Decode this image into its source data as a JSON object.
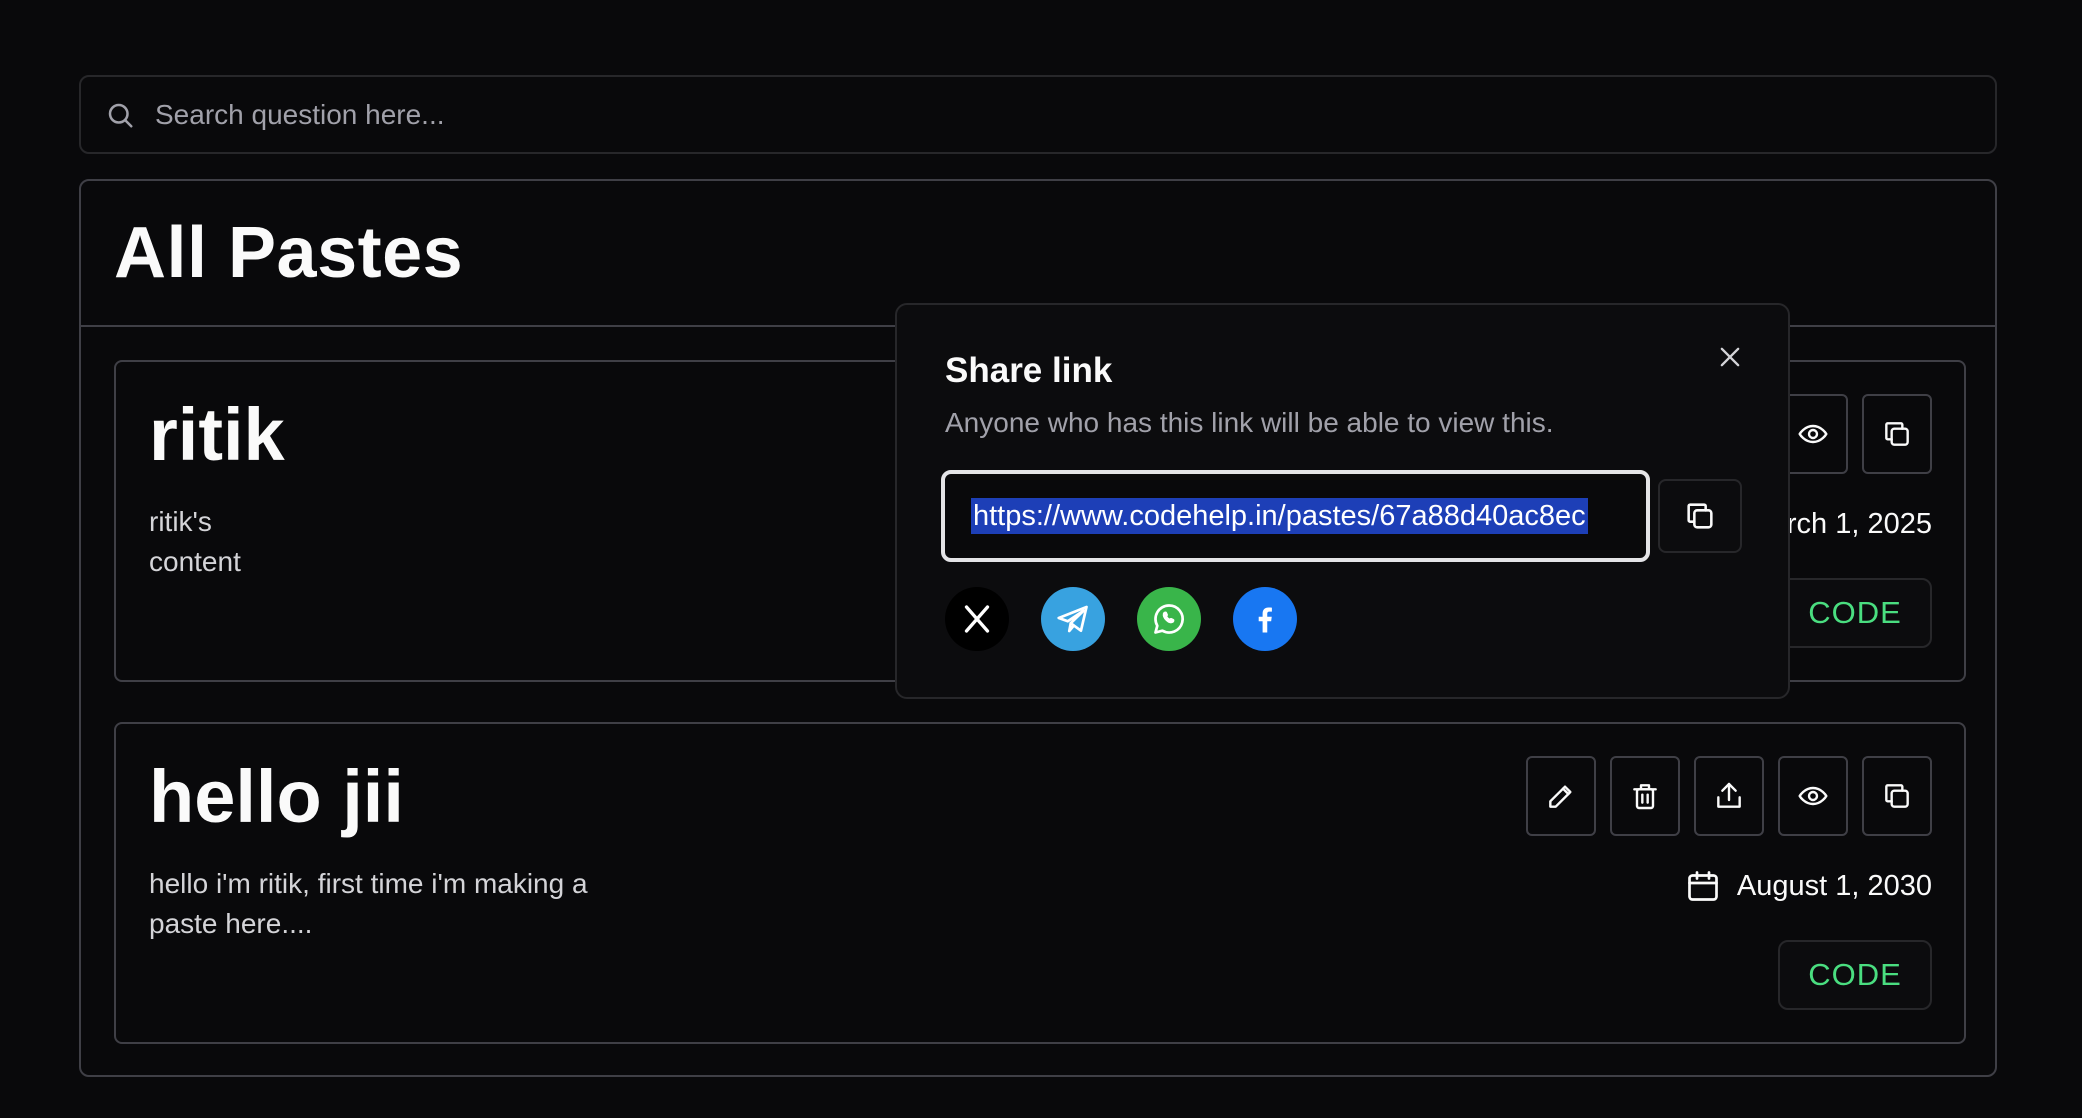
{
  "search": {
    "placeholder": "Search question here..."
  },
  "panel": {
    "title": "All Pastes"
  },
  "pastes": [
    {
      "title": "ritik",
      "content_line1": "ritik's",
      "content_line2": "content",
      "date": "March 1, 2025",
      "code_label": "CODE"
    },
    {
      "title": "hello jii",
      "content_line1": "hello i'm ritik, first time i'm making a",
      "content_line2": "paste here....",
      "date": "August 1, 2030",
      "code_label": "CODE"
    }
  ],
  "share_modal": {
    "title": "Share link",
    "description": "Anyone who has this link will be able to view this.",
    "link": "https://www.codehelp.in/pastes/67a88d40ac8ec",
    "socials": [
      "x-icon",
      "telegram-icon",
      "whatsapp-icon",
      "facebook-icon"
    ]
  },
  "colors": {
    "background": "#09090b",
    "border": "#3f3f46",
    "code_text": "#4ade80",
    "link_highlight": "#1d3fb7",
    "telegram": "#38a2e0",
    "whatsapp": "#39b54a",
    "facebook": "#1877f2"
  }
}
